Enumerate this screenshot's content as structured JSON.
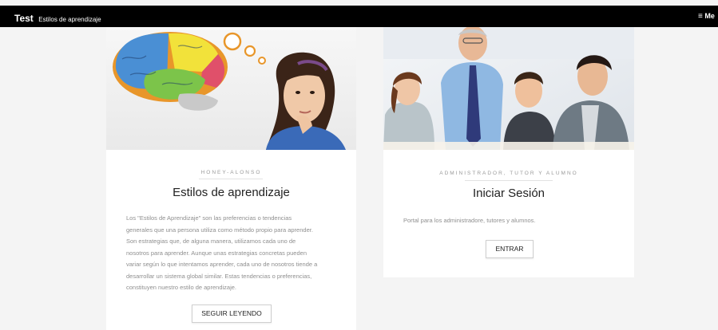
{
  "navbar": {
    "brand_name": "Test",
    "brand_subtitle": "Estilos de aprendizaje",
    "menu_label": "Me",
    "menu_icon": "hamburger-icon"
  },
  "cards": [
    {
      "image": "brain-illustration-woman-thinking",
      "eyebrow": "HONEY-ALONSO",
      "title": "Estilos de aprendizaje",
      "body_lines": [
        "Los \"Estilos de Aprendizaje\" son las preferencias o tendencias",
        "generales que una persona utiliza como método propio para aprender.",
        "Son estrategias que, de alguna manera, utilizamos cada uno de",
        "nosotros para aprender. Aunque unas estrategias concretas pueden",
        "variar según lo que intentamos aprender, cada uno de nosotros tiende a",
        "desarrollar un sistema global similar. Estas tendencias o preferencias,",
        "constituyen nuestro estilo de aprendizaje."
      ],
      "button": "SEGUIR LEYENDO"
    },
    {
      "image": "teacher-with-students-photo",
      "eyebrow": "ADMINISTRADOR, TUTOR Y ALUMNO",
      "title": "Iniciar Sesión",
      "body": "Portal para los administradore, tutores y alumnos.",
      "button": "ENTRAR"
    }
  ],
  "colors": {
    "navbar_bg": "#000000",
    "page_bg": "#f4f4f4",
    "card_bg": "#ffffff"
  }
}
